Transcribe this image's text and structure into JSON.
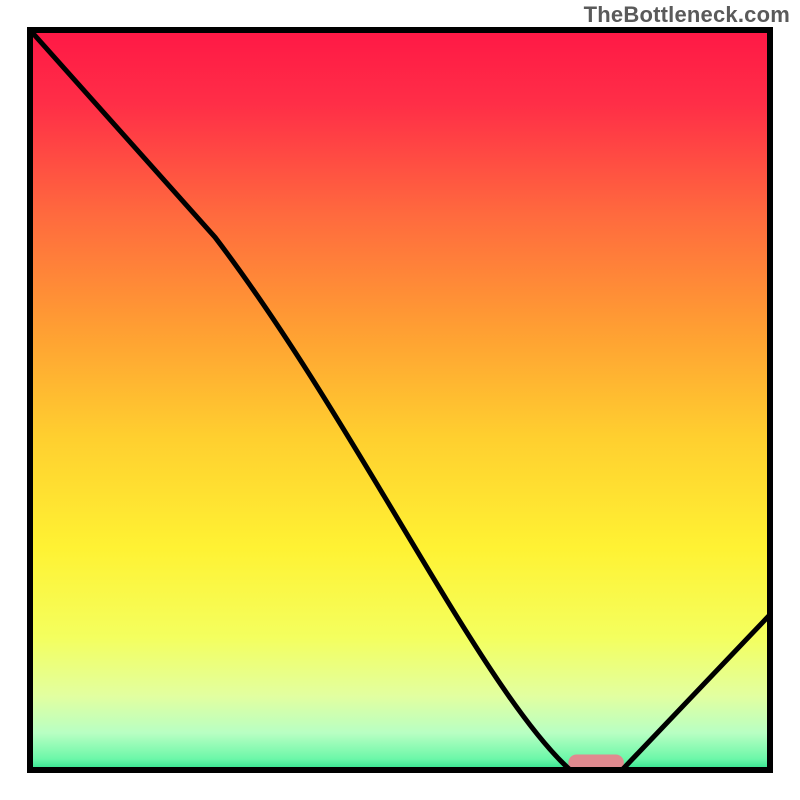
{
  "watermark": "TheBottleneck.com",
  "chart_data": {
    "type": "line",
    "title": "",
    "xlabel": "",
    "ylabel": "",
    "xlim": [
      0,
      100
    ],
    "ylim": [
      0,
      100
    ],
    "x": [
      0,
      25,
      73,
      80,
      100
    ],
    "values": [
      100,
      72,
      0,
      0,
      21
    ],
    "highlight_segment": {
      "x_start": 73,
      "x_end": 80,
      "y": 0
    },
    "gradient_stops": [
      {
        "offset": 0.0,
        "color": "#ff1846"
      },
      {
        "offset": 0.1,
        "color": "#ff2e47"
      },
      {
        "offset": 0.25,
        "color": "#ff6a3e"
      },
      {
        "offset": 0.4,
        "color": "#ff9d33"
      },
      {
        "offset": 0.55,
        "color": "#ffcf2f"
      },
      {
        "offset": 0.7,
        "color": "#fff233"
      },
      {
        "offset": 0.82,
        "color": "#f4ff5e"
      },
      {
        "offset": 0.9,
        "color": "#e2ffa0"
      },
      {
        "offset": 0.95,
        "color": "#b8ffc3"
      },
      {
        "offset": 0.985,
        "color": "#6cf7a9"
      },
      {
        "offset": 1.0,
        "color": "#2de08b"
      }
    ],
    "pill": {
      "color": "#e08a8f",
      "x": 76.5,
      "y": 1.0,
      "w": 7.5,
      "h": 2.2
    }
  },
  "colors": {
    "border": "#000000",
    "line": "#000000",
    "pill": "#e08a8f"
  }
}
